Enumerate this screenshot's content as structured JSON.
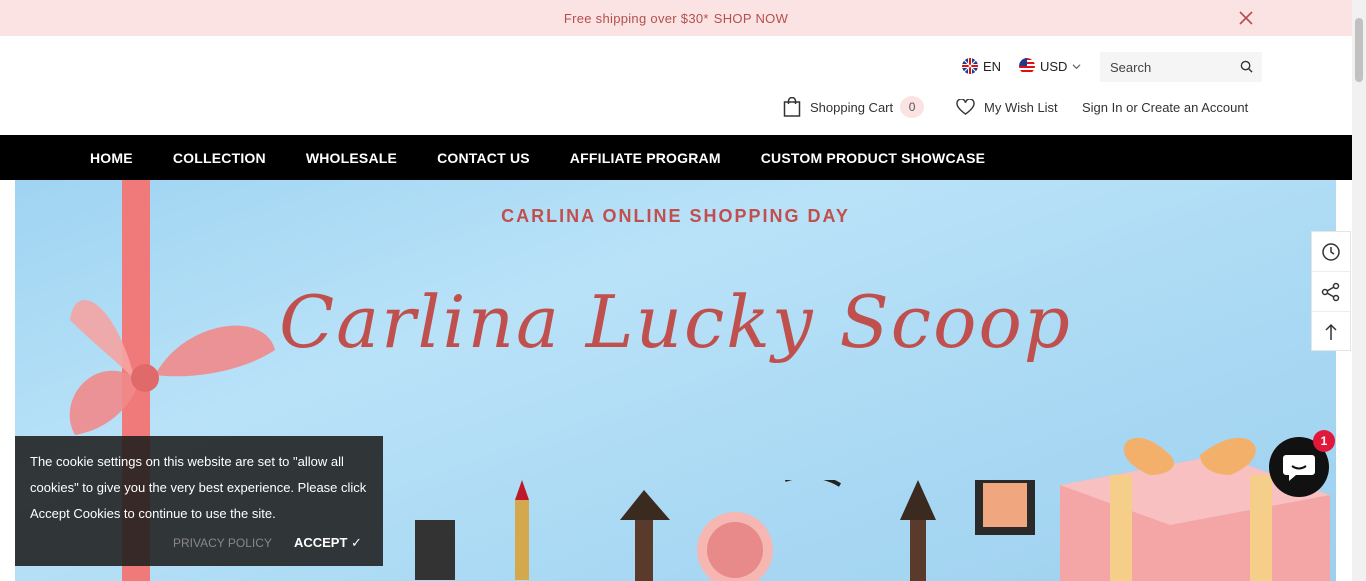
{
  "announcement": {
    "text": "Free shipping over $30*",
    "link": "SHOP NOW"
  },
  "header": {
    "language": "EN",
    "currency": "USD",
    "search_placeholder": "Search",
    "cart_label": "Shopping Cart",
    "cart_count": "0",
    "wishlist_label": "My Wish List",
    "signin_label": "Sign In or Create an Account"
  },
  "nav": {
    "items": [
      "HOME",
      "COLLECTION",
      "WHOLESALE",
      "CONTACT US",
      "AFFILIATE PROGRAM",
      "CUSTOM PRODUCT SHOWCASE"
    ]
  },
  "hero": {
    "subtitle": "CARLINA ONLINE SHOPPING DAY",
    "title": "Carlina Lucky Scoop"
  },
  "cookie": {
    "message": "The cookie settings on this website are set to \"allow all cookies\" to give you the very best experience. Please click Accept Cookies to continue to use the site.",
    "privacy": "PRIVACY POLICY",
    "accept": "ACCEPT"
  },
  "chat": {
    "badge": "1"
  },
  "colors": {
    "accent": "#c0504d",
    "announce_bg": "#fce3e3",
    "nav_bg": "#000000"
  }
}
